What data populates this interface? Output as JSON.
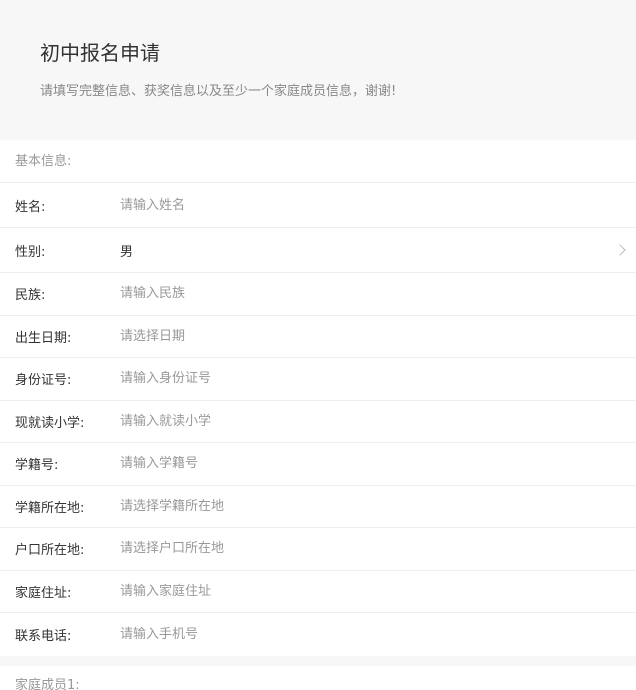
{
  "header": {
    "title": "初中报名申请",
    "subtitle": "请填写完整信息、获奖信息以及至少一个家庭成员信息，谢谢!"
  },
  "basic_info": {
    "title": "基本信息:",
    "fields": [
      {
        "label": "姓名:",
        "placeholder": "请输入姓名"
      },
      {
        "label": "性别:",
        "value": "男"
      },
      {
        "label": "民族:",
        "placeholder": "请输入民族"
      },
      {
        "label": "出生日期:",
        "placeholder": "请选择日期"
      },
      {
        "label": "身份证号:",
        "placeholder": "请输入身份证号"
      },
      {
        "label": "现就读小学:",
        "placeholder": "请输入就读小学"
      },
      {
        "label": "学籍号:",
        "placeholder": "请输入学籍号"
      },
      {
        "label": "学籍所在地:",
        "placeholder": "请选择学籍所在地"
      },
      {
        "label": "户口所在地:",
        "placeholder": "请选择户口所在地"
      },
      {
        "label": "家庭住址:",
        "placeholder": "请输入家庭住址"
      },
      {
        "label": "联系电话:",
        "placeholder": "请输入手机号"
      }
    ]
  },
  "family_member": {
    "title": "家庭成员1:"
  }
}
